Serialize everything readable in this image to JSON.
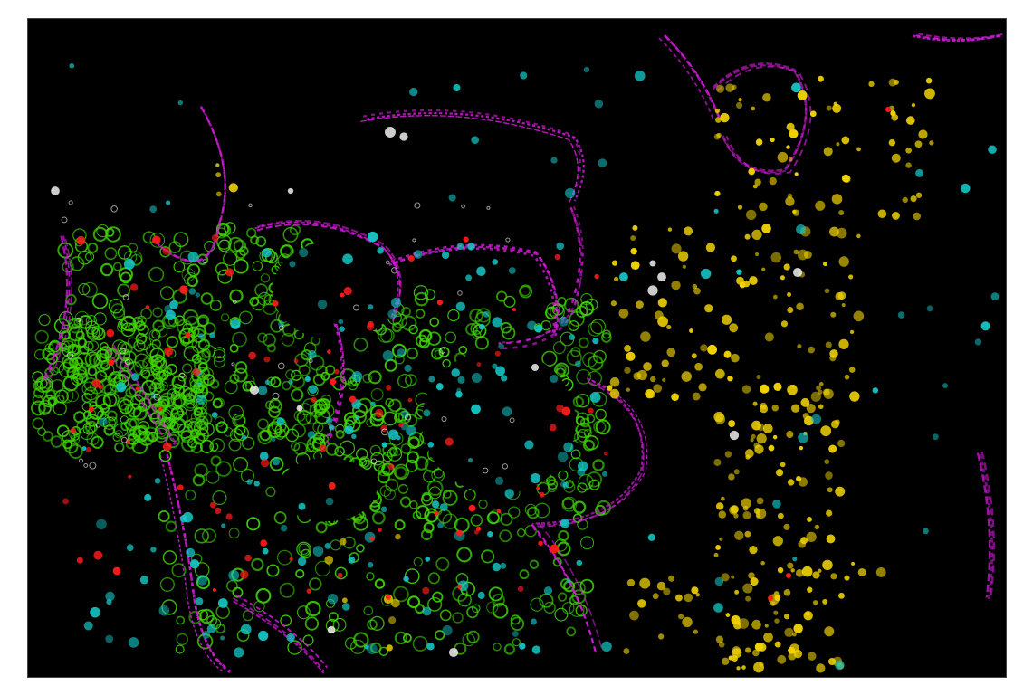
{
  "image": {
    "description_type": "multiplex-immunofluorescence-micrograph",
    "background": "#000000",
    "frame_border": "#444444",
    "channels": [
      {
        "name": "green-channel",
        "color": "#3fd400"
      },
      {
        "name": "cyan-channel",
        "color": "#16c9c9"
      },
      {
        "name": "magenta-channel",
        "color": "#d21ad8"
      },
      {
        "name": "yellow-channel",
        "color": "#f1d300"
      },
      {
        "name": "red-channel",
        "color": "#ff1a1a"
      },
      {
        "name": "white-channel",
        "color": "#ffffff"
      }
    ]
  }
}
